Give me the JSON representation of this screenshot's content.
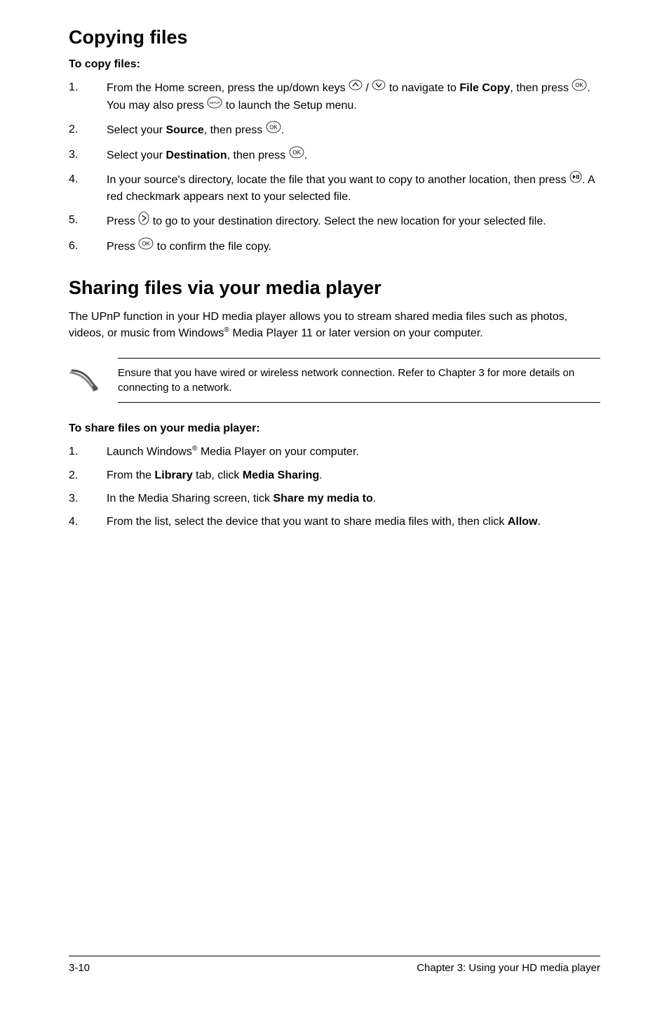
{
  "section1": {
    "heading": "Copying files",
    "subhead": "To copy files:",
    "steps": [
      {
        "pre": "From the Home screen, press the up/down keys ",
        "mid1": " / ",
        "mid2": " to navigate to ",
        "bold1": "File Copy",
        "mid3": ", then press ",
        "mid4": ". You may also press ",
        "post": " to launch the Setup menu."
      },
      {
        "pre": "Select your ",
        "bold1": "Source",
        "mid1": ", then press ",
        "post": "."
      },
      {
        "pre": "Select your ",
        "bold1": "Destination",
        "mid1": ", then press ",
        "post": "."
      },
      {
        "pre": "In your source's directory, locate the file that you want to copy to another location, then press ",
        "post": ". A red checkmark appears next to your selected file."
      },
      {
        "pre": "Press ",
        "post": " to go to your destination directory. Select the new location for your selected file."
      },
      {
        "pre": "Press ",
        "post": " to confirm the file copy."
      }
    ]
  },
  "section2": {
    "heading": "Sharing files via your media player",
    "body_pre": "The UPnP function in your HD media player allows you to stream shared media files such as photos, videos, or music from Windows",
    "body_post": " Media Player 11 or later version on your computer.",
    "note": "Ensure that you have wired or wireless network connection. Refer to Chapter 3 for more details on connecting to a network.",
    "subhead": "To share files on your media player:",
    "steps": [
      {
        "pre": "Launch Windows",
        "post": " Media Player on your computer."
      },
      {
        "pre": "From the ",
        "bold1": "Library",
        "mid1": " tab, click ",
        "bold2": "Media Sharing",
        "post": "."
      },
      {
        "pre": "In the Media Sharing screen, tick ",
        "bold1": "Share my media to",
        "post": "."
      },
      {
        "pre": "From the list, select the device that you want to share media files with, then click ",
        "bold1": "Allow",
        "post": "."
      }
    ]
  },
  "footer": {
    "page": "3-10",
    "chapter": "Chapter 3: Using your HD media player"
  },
  "sup_r": "®"
}
